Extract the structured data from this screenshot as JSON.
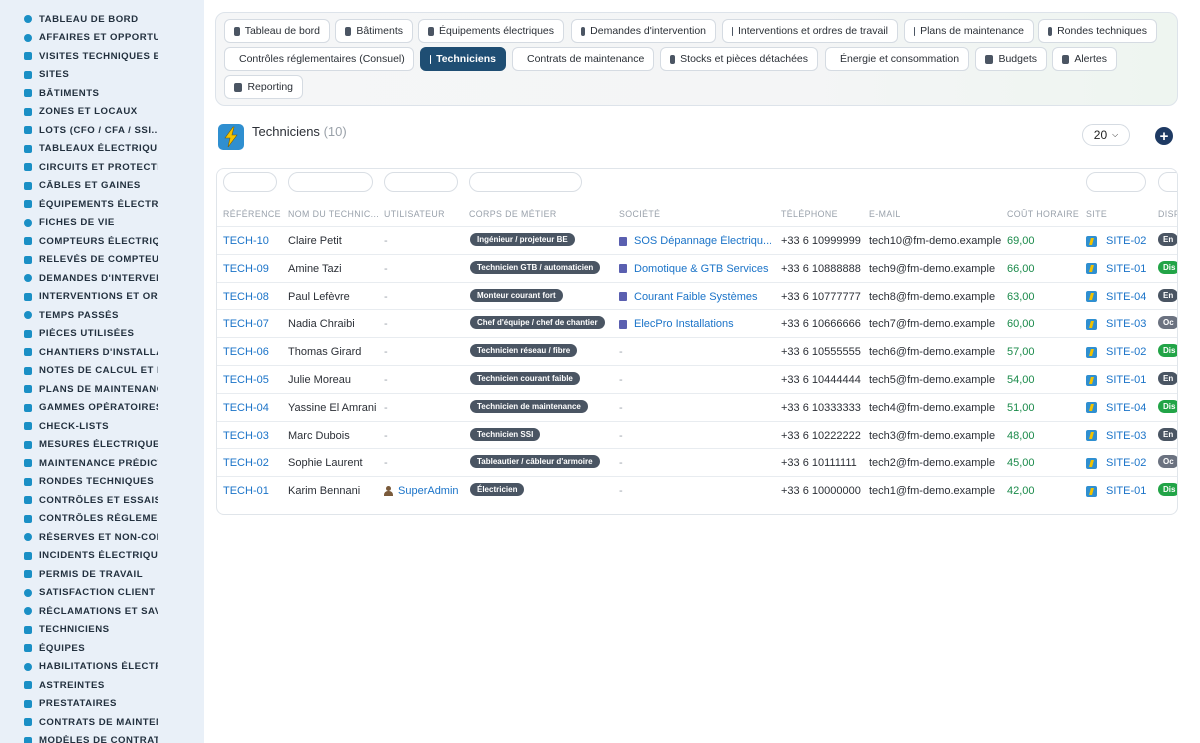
{
  "sidebar": {
    "items": [
      {
        "label": "TABLEAU DE BORD",
        "icon": "dashboard-icon"
      },
      {
        "label": "AFFAIRES ET OPPORTUN",
        "icon": "target-icon"
      },
      {
        "label": "VISITES TECHNIQUES ET",
        "icon": "clipboard-icon"
      },
      {
        "label": "SITES",
        "icon": "map-pin-icon"
      },
      {
        "label": "BÂTIMENTS",
        "icon": "building-icon"
      },
      {
        "label": "ZONES ET LOCAUX",
        "icon": "grid-icon"
      },
      {
        "label": "LOTS (CFO / CFA / SSI...)",
        "icon": "sitemap-icon"
      },
      {
        "label": "TABLEAUX ÉLECTRIQUES",
        "icon": "table-icon"
      },
      {
        "label": "CIRCUITS ET PROTECTIO",
        "icon": "circuit-icon"
      },
      {
        "label": "CÂBLES ET GAINES",
        "icon": "lines-icon"
      },
      {
        "label": "ÉQUIPEMENTS ÉLECTRIQ",
        "icon": "cogs-icon"
      },
      {
        "label": "FICHES DE VIE",
        "icon": "history-icon"
      },
      {
        "label": "COMPTEURS ÉLECTRIQU",
        "icon": "gauge-icon"
      },
      {
        "label": "RELEVÉS DE COMPTEURS",
        "icon": "list-icon"
      },
      {
        "label": "DEMANDES D'INTERVENT",
        "icon": "question-icon"
      },
      {
        "label": "INTERVENTIONS ET ORDI",
        "icon": "clipboard-check-icon"
      },
      {
        "label": "TEMPS PASSÉS",
        "icon": "clock-icon"
      },
      {
        "label": "PIÈCES UTILISÉES",
        "icon": "boxes-icon"
      },
      {
        "label": "CHANTIERS D'INSTALLAT",
        "icon": "hammer-icon"
      },
      {
        "label": "NOTES DE CALCUL ET ÉT",
        "icon": "calculator-icon"
      },
      {
        "label": "PLANS DE MAINTENANCE",
        "icon": "calendar-icon"
      },
      {
        "label": "GAMMES OPÉRATOIRES",
        "icon": "list-ol-icon"
      },
      {
        "label": "CHECK-LISTS",
        "icon": "checklist-icon"
      },
      {
        "label": "MESURES ÉLECTRIQUES",
        "icon": "gauge-icon"
      },
      {
        "label": "MAINTENANCE PRÉDICTI",
        "icon": "chart-line-icon"
      },
      {
        "label": "RONDES TECHNIQUES",
        "icon": "route-icon"
      },
      {
        "label": "CONTRÔLES ET ESSAIS",
        "icon": "search-icon"
      },
      {
        "label": "CONTRÔLES RÉGLEMENT",
        "icon": "clipboard-icon"
      },
      {
        "label": "RÉSERVES ET NON-CONF",
        "icon": "exclamation-icon"
      },
      {
        "label": "INCIDENTS ÉLECTRIQUES",
        "icon": "warning-icon"
      },
      {
        "label": "PERMIS DE TRAVAIL",
        "icon": "file-signature-icon"
      },
      {
        "label": "SATISFACTION CLIENT",
        "icon": "smile-icon"
      },
      {
        "label": "RÉCLAMATIONS ET SAV",
        "icon": "comment-icon"
      },
      {
        "label": "TECHNICIENS",
        "icon": "hard-hat-icon"
      },
      {
        "label": "ÉQUIPES",
        "icon": "users-icon"
      },
      {
        "label": "HABILITATIONS ÉLECTRI",
        "icon": "certificate-icon"
      },
      {
        "label": "ASTREINTES",
        "icon": "phone-icon"
      },
      {
        "label": "PRESTATAIRES",
        "icon": "handshake-icon"
      },
      {
        "label": "CONTRATS DE MAINTENA",
        "icon": "file-contract-icon"
      },
      {
        "label": "MODÈLES DE CONTRATS",
        "icon": "file-icon"
      }
    ]
  },
  "tabs": [
    {
      "label": "Tableau de bord",
      "icon": "dashboard-icon",
      "active": false
    },
    {
      "label": "Bâtiments",
      "icon": "building-icon",
      "active": false
    },
    {
      "label": "Équipements électriques",
      "icon": "cogs-icon",
      "active": false
    },
    {
      "label": "Demandes d'intervention",
      "icon": "question-icon",
      "active": false
    },
    {
      "label": "Interventions et ordres de travail",
      "icon": "clipboard-check-icon",
      "active": false
    },
    {
      "label": "Plans de maintenance",
      "icon": "calendar-icon",
      "active": false
    },
    {
      "label": "Rondes techniques",
      "icon": "route-icon",
      "active": false
    },
    {
      "label": "Contrôles réglementaires (Consuel)",
      "icon": "clipboard-icon",
      "active": false
    },
    {
      "label": "Techniciens",
      "icon": "hard-hat-icon",
      "active": true
    },
    {
      "label": "Contrats de maintenance",
      "icon": "file-contract-icon",
      "active": false
    },
    {
      "label": "Stocks et pièces détachées",
      "icon": "sitemap-icon",
      "active": false
    },
    {
      "label": "Énergie et consommation",
      "icon": "bolt-icon",
      "active": false
    },
    {
      "label": "Budgets",
      "icon": "money-icon",
      "active": false
    },
    {
      "label": "Alertes",
      "icon": "bell-icon",
      "active": false
    },
    {
      "label": "Reporting",
      "icon": "chart-pie-icon",
      "active": false
    }
  ],
  "header": {
    "title": "Techniciens",
    "count": "(10)",
    "per_page": "20"
  },
  "table": {
    "columns": [
      "RÉFÉRENCE",
      "NOM DU TECHNIC...",
      "UTILISATEUR",
      "CORPS DE MÉTIER",
      "SOCIÉTÉ",
      "TÉLÉPHONE",
      "E-MAIL",
      "COÛT HORAIRE",
      "SITE",
      "DISP"
    ],
    "rows": [
      {
        "ref": "TECH-10",
        "nom": "Claire Petit",
        "user": "-",
        "corps": "Ingénieur / projeteur BE",
        "societe": "SOS Dépannage Électriqu...",
        "tel": "+33 6 10999999",
        "email": "tech10@fm-demo.example",
        "cout": "69,00",
        "site": "SITE-02",
        "disp": "En"
      },
      {
        "ref": "TECH-09",
        "nom": "Amine Tazi",
        "user": "-",
        "corps": "Technicien GTB / automaticien",
        "societe": "Domotique & GTB Services",
        "tel": "+33 6 10888888",
        "email": "tech9@fm-demo.example",
        "cout": "66,00",
        "site": "SITE-01",
        "disp": "Dis"
      },
      {
        "ref": "TECH-08",
        "nom": "Paul Lefèvre",
        "user": "-",
        "corps": "Monteur courant fort",
        "societe": "Courant Faible Systèmes",
        "tel": "+33 6 10777777",
        "email": "tech8@fm-demo.example",
        "cout": "63,00",
        "site": "SITE-04",
        "disp": "En"
      },
      {
        "ref": "TECH-07",
        "nom": "Nadia Chraibi",
        "user": "-",
        "corps": "Chef d'équipe / chef de chantier",
        "societe": "ElecPro Installations",
        "tel": "+33 6 10666666",
        "email": "tech7@fm-demo.example",
        "cout": "60,00",
        "site": "SITE-03",
        "disp": "Oc"
      },
      {
        "ref": "TECH-06",
        "nom": "Thomas Girard",
        "user": "-",
        "corps": "Technicien réseau / fibre",
        "societe": "-",
        "tel": "+33 6 10555555",
        "email": "tech6@fm-demo.example",
        "cout": "57,00",
        "site": "SITE-02",
        "disp": "Dis"
      },
      {
        "ref": "TECH-05",
        "nom": "Julie Moreau",
        "user": "-",
        "corps": "Technicien courant faible",
        "societe": "-",
        "tel": "+33 6 10444444",
        "email": "tech5@fm-demo.example",
        "cout": "54,00",
        "site": "SITE-01",
        "disp": "En"
      },
      {
        "ref": "TECH-04",
        "nom": "Yassine El Amrani",
        "user": "-",
        "corps": "Technicien de maintenance",
        "societe": "-",
        "tel": "+33 6 10333333",
        "email": "tech4@fm-demo.example",
        "cout": "51,00",
        "site": "SITE-04",
        "disp": "Dis"
      },
      {
        "ref": "TECH-03",
        "nom": "Marc Dubois",
        "user": "-",
        "corps": "Technicien SSI",
        "societe": "-",
        "tel": "+33 6 10222222",
        "email": "tech3@fm-demo.example",
        "cout": "48,00",
        "site": "SITE-03",
        "disp": "En"
      },
      {
        "ref": "TECH-02",
        "nom": "Sophie Laurent",
        "user": "-",
        "corps": "Tableautier / câbleur d'armoire",
        "societe": "-",
        "tel": "+33 6 10111111",
        "email": "tech2@fm-demo.example",
        "cout": "45,00",
        "site": "SITE-02",
        "disp": "Oc"
      },
      {
        "ref": "TECH-01",
        "nom": "Karim Bennani",
        "user": "SuperAdmin",
        "corps": "Électricien",
        "societe": "-",
        "tel": "+33 6 10000000",
        "email": "tech1@fm-demo.example",
        "cout": "42,00",
        "site": "SITE-01",
        "disp": "Dis"
      }
    ]
  },
  "colors": {
    "accent": "#1a73c8",
    "active_tab": "#1f4e73",
    "sidebar_bg": "#e9f0f8",
    "badge_dark": "#4a5563",
    "status_available": "#22a447",
    "cost_green": "#1a8a4a"
  }
}
